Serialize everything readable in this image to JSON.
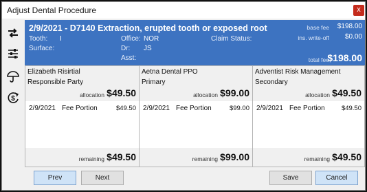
{
  "window": {
    "title": "Adjust Dental Procedure",
    "close_glyph": "x"
  },
  "toolbar": {
    "icons": [
      "swap-arrows-icon",
      "sliders-icon",
      "umbrella-icon",
      "dollar-refresh-icon"
    ]
  },
  "header": {
    "procedure": "2/9/2021 - D7140 Extraction, erupted tooth or exposed root",
    "tooth_label": "Tooth:",
    "tooth_value": "I",
    "surface_label": "Surface:",
    "office_label": "Office:",
    "office_value": "NOR",
    "dr_label": "Dr:",
    "dr_value": "JS",
    "asst_label": "Asst:",
    "claim_status_label": "Claim Status:",
    "base_fee_label": "base fee",
    "base_fee_value": "$198.00",
    "write_off_label": "ins. write-off",
    "write_off_value": "$0.00",
    "total_fee_label": "total fee",
    "total_fee_value": "$198.00"
  },
  "panels": [
    {
      "name": "Elizabeth Risirtial",
      "role": "Responsible Party",
      "allocation_label": "allocation",
      "allocation": "$49.50",
      "row": {
        "date": "2/9/2021",
        "desc": "Fee Portion",
        "amount": "$49.50"
      },
      "remaining_label": "remaining",
      "remaining": "$49.50"
    },
    {
      "name": "Aetna Dental PPO",
      "role": "Primary",
      "allocation_label": "allocation",
      "allocation": "$99.00",
      "row": {
        "date": "2/9/2021",
        "desc": "Fee Portion",
        "amount": "$99.00"
      },
      "remaining_label": "remaining",
      "remaining": "$99.00"
    },
    {
      "name": "Adventist Risk Management",
      "role": "Secondary",
      "allocation_label": "allocation",
      "allocation": "$49.50",
      "row": {
        "date": "2/9/2021",
        "desc": "Fee Portion",
        "amount": "$49.50"
      },
      "remaining_label": "remaining",
      "remaining": "$49.50"
    }
  ],
  "buttons": {
    "prev": "Prev",
    "next": "Next",
    "save": "Save",
    "cancel": "Cancel"
  }
}
